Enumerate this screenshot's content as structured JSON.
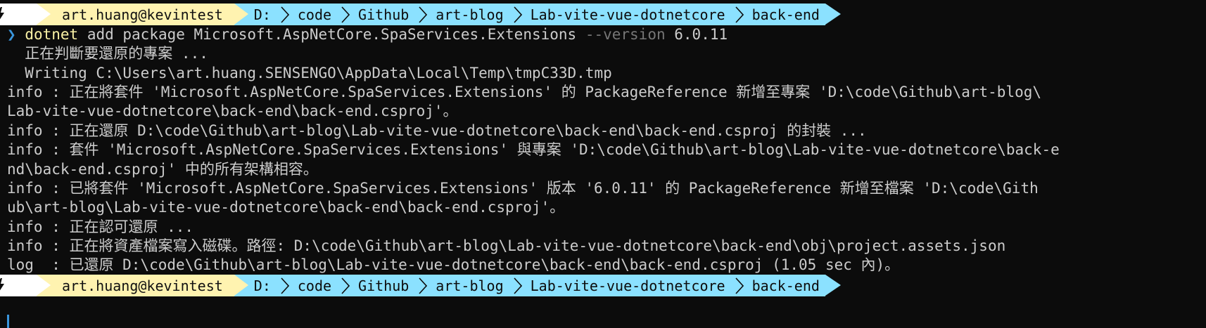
{
  "prompt": {
    "bolt_icon": "lightning-icon",
    "user_host": "art.huang@kevintest",
    "path": [
      "D:",
      "code",
      "Github",
      "art-blog",
      "Lab-vite-vue-dotnetcore",
      "back-end"
    ],
    "colors": {
      "bolt_bg": "#ffffff",
      "user_bg": "#fff3b0",
      "path_bg": "#8be1ff"
    }
  },
  "command": {
    "prompt_symbol": "❯",
    "program": "dotnet",
    "args": " add package Microsoft.AspNetCore.SpaServices.Extensions ",
    "flag": "--version",
    "flag_value": " 6.0.11"
  },
  "output": [
    "  正在判斷要還原的專案 ...",
    "  Writing C:\\Users\\art.huang.SENSENGO\\AppData\\Local\\Temp\\tmpC33D.tmp",
    "info : 正在將套件 'Microsoft.AspNetCore.SpaServices.Extensions' 的 PackageReference 新增至專案 'D:\\code\\Github\\art-blog\\",
    "Lab-vite-vue-dotnetcore\\back-end\\back-end.csproj'。",
    "info : 正在還原 D:\\code\\Github\\art-blog\\Lab-vite-vue-dotnetcore\\back-end\\back-end.csproj 的封裝 ...",
    "info : 套件 'Microsoft.AspNetCore.SpaServices.Extensions' 與專案 'D:\\code\\Github\\art-blog\\Lab-vite-vue-dotnetcore\\back-e",
    "nd\\back-end.csproj' 中的所有架構相容。",
    "info : 已將套件 'Microsoft.AspNetCore.SpaServices.Extensions' 版本 '6.0.11' 的 PackageReference 新增至檔案 'D:\\code\\Gith",
    "ub\\art-blog\\Lab-vite-vue-dotnetcore\\back-end\\back-end.csproj'。",
    "info : 正在認可還原 ...",
    "info : 正在將資產檔案寫入磁碟。路徑: D:\\code\\Github\\art-blog\\Lab-vite-vue-dotnetcore\\back-end\\obj\\project.assets.json",
    "log  : 已還原 D:\\code\\Github\\art-blog\\Lab-vite-vue-dotnetcore\\back-end\\back-end.csproj (1.05 sec 內)。"
  ],
  "colors": {
    "background": "#0c0c0c",
    "foreground": "#cccccc",
    "program": "#f9f1a5",
    "flag": "#767676",
    "prompt_symbol": "#3a96dd"
  }
}
